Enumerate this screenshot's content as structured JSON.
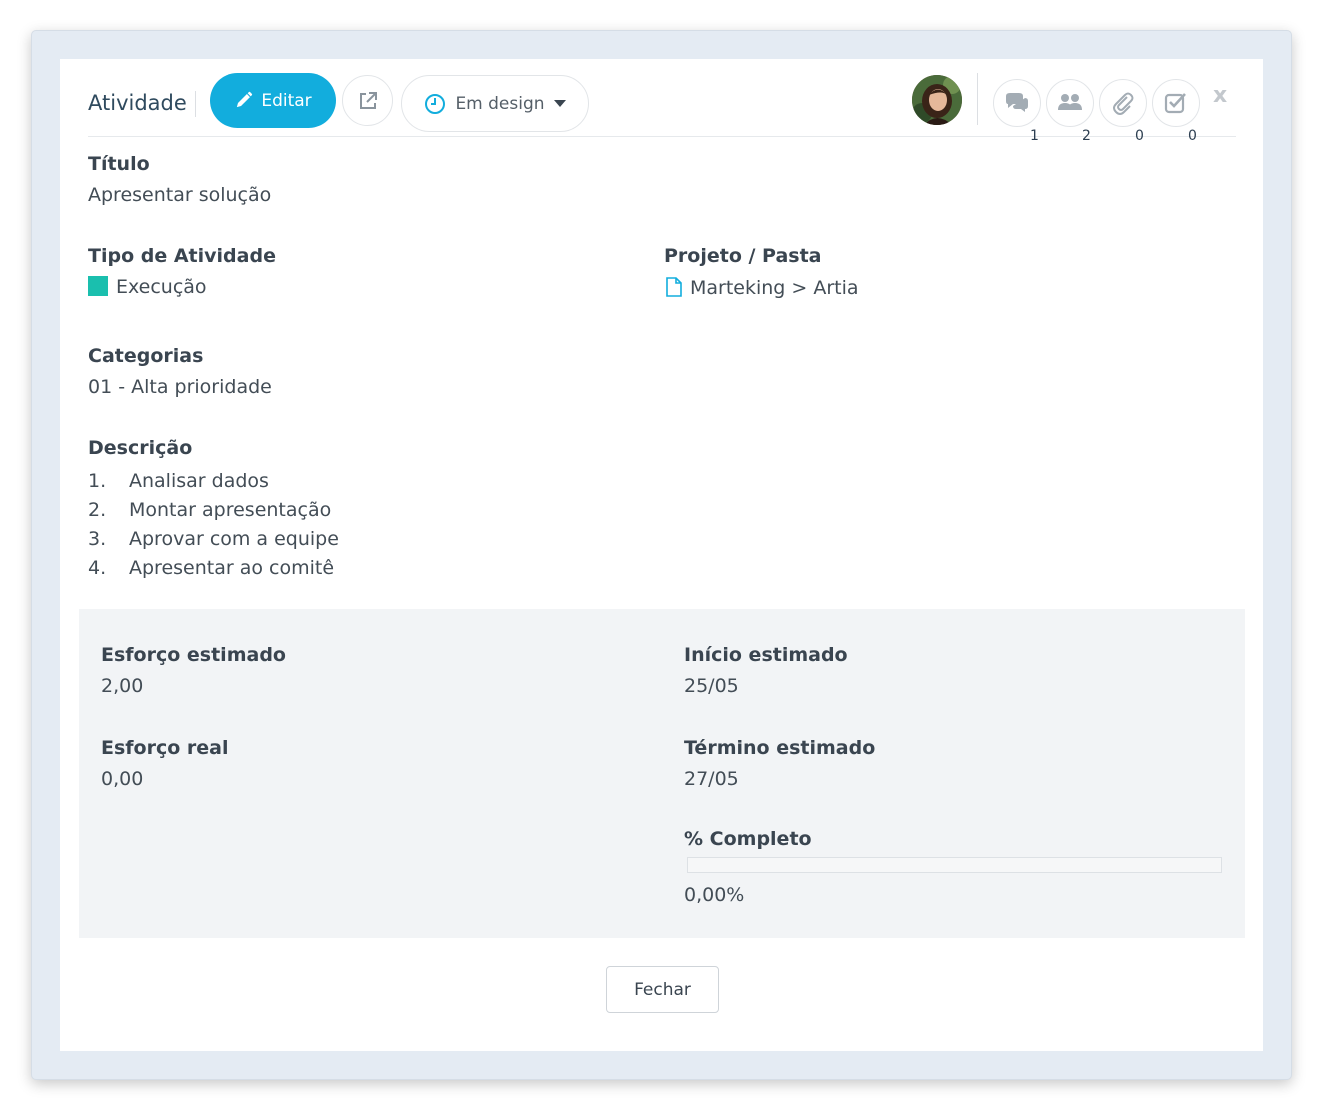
{
  "header": {
    "title": "Atividade",
    "edit_label": "Editar",
    "status_label": "Em design",
    "counts": {
      "comments": "1",
      "members": "2",
      "attachments": "0",
      "checklist": "0"
    },
    "close_label": "x"
  },
  "fields": {
    "titulo_label": "Título",
    "titulo_value": "Apresentar solução",
    "tipo_label": "Tipo de Atividade",
    "tipo_value": "Execução",
    "tipo_color": "#1abfae",
    "projeto_label": "Projeto / Pasta",
    "projeto_value": "Marteking > Artia",
    "categorias_label": "Categorias",
    "categorias_value": "01 - Alta prioridade",
    "descricao_label": "Descrição",
    "descricao_items": [
      {
        "num": "1.",
        "text": "Analisar dados"
      },
      {
        "num": "2.",
        "text": "Montar apresentação"
      },
      {
        "num": "3.",
        "text": "Aprovar com a equipe"
      },
      {
        "num": "4.",
        "text": "Apresentar ao comitê"
      }
    ]
  },
  "summary": {
    "esforco_estimado_label": "Esforço estimado",
    "esforco_estimado_value": "2,00",
    "esforco_real_label": "Esforço real",
    "esforco_real_value": "0,00",
    "inicio_label": "Início estimado",
    "inicio_value": "25/05",
    "termino_label": "Término estimado",
    "termino_value": "27/05",
    "completo_label": "% Completo",
    "completo_value": "0,00%",
    "completo_fraction": 0
  },
  "footer": {
    "fechar_label": "Fechar"
  },
  "colors": {
    "accent": "#12addd",
    "panel": "#f2f4f6"
  },
  "icons": [
    "pencil-icon",
    "external-link-icon",
    "clock-icon",
    "caret-down-icon",
    "comments-icon",
    "users-icon",
    "paperclip-icon",
    "checklist-icon",
    "file-icon",
    "close-icon"
  ]
}
